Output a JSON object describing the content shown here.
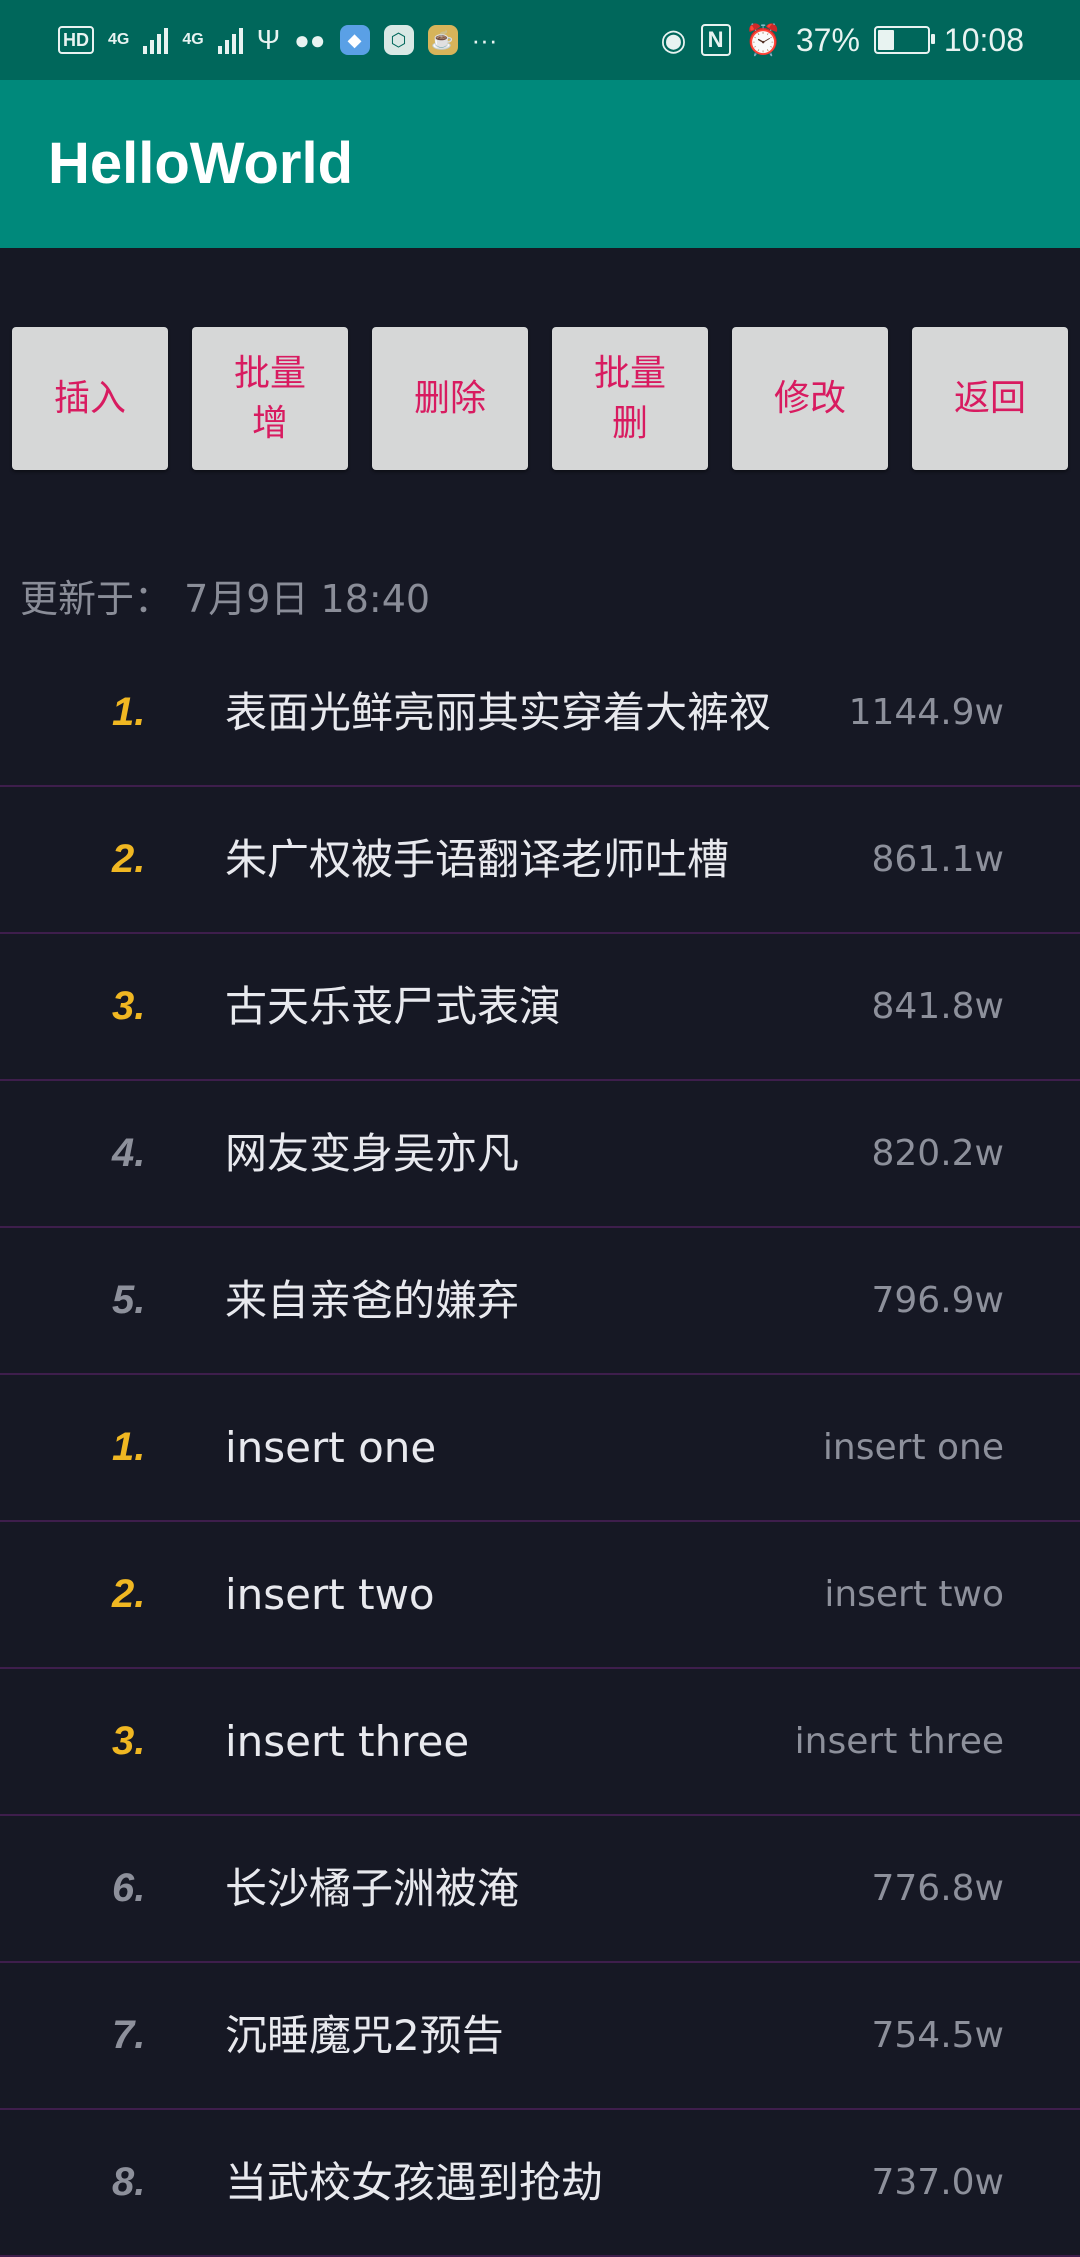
{
  "status_bar": {
    "left_icons": [
      "hd-icon",
      "signal-4g-icon",
      "signal-4g-icon",
      "usb-icon",
      "wechat-icon",
      "app-icon",
      "app-icon",
      "app-icon",
      "more-icon"
    ],
    "hd": "HD",
    "net1": "4G",
    "net2": "4G",
    "more": "···",
    "battery_percent": "37%",
    "battery_level": 0.37,
    "time": "10:08"
  },
  "app_bar": {
    "title": "HelloWorld"
  },
  "buttons": [
    {
      "label": "插入"
    },
    {
      "label": "批量增"
    },
    {
      "label": "删除"
    },
    {
      "label": "批量删"
    },
    {
      "label": "修改"
    },
    {
      "label": "返回"
    }
  ],
  "updated": {
    "label": "更新于：",
    "value": "7月9日 18:40"
  },
  "list": [
    {
      "rank": "1.",
      "title": "表面光鲜亮丽其实穿着大裤衩",
      "value": "1144.9w",
      "highlight": true
    },
    {
      "rank": "2.",
      "title": "朱广权被手语翻译老师吐槽",
      "value": "861.1w",
      "highlight": true
    },
    {
      "rank": "3.",
      "title": "古天乐丧尸式表演",
      "value": "841.8w",
      "highlight": true
    },
    {
      "rank": "4.",
      "title": "网友变身吴亦凡",
      "value": "820.2w",
      "highlight": false
    },
    {
      "rank": "5.",
      "title": "来自亲爸的嫌弃",
      "value": "796.9w",
      "highlight": false
    },
    {
      "rank": "1.",
      "title": "insert one",
      "value": "insert one",
      "highlight": true
    },
    {
      "rank": "2.",
      "title": "insert two",
      "value": "insert two",
      "highlight": true
    },
    {
      "rank": "3.",
      "title": "insert three",
      "value": "insert three",
      "highlight": true
    },
    {
      "rank": "6.",
      "title": "长沙橘子洲被淹",
      "value": "776.8w",
      "highlight": false
    },
    {
      "rank": "7.",
      "title": "沉睡魔咒2预告",
      "value": "754.5w",
      "highlight": false
    },
    {
      "rank": "8.",
      "title": "当武校女孩遇到抢劫",
      "value": "737.0w",
      "highlight": false
    }
  ],
  "colors": {
    "app_bar": "#00897b",
    "status_bar": "#00675b",
    "background": "#161824",
    "button_text": "#d81b60",
    "rank_highlight": "#f0b722",
    "divider": "#3e1e4c"
  }
}
